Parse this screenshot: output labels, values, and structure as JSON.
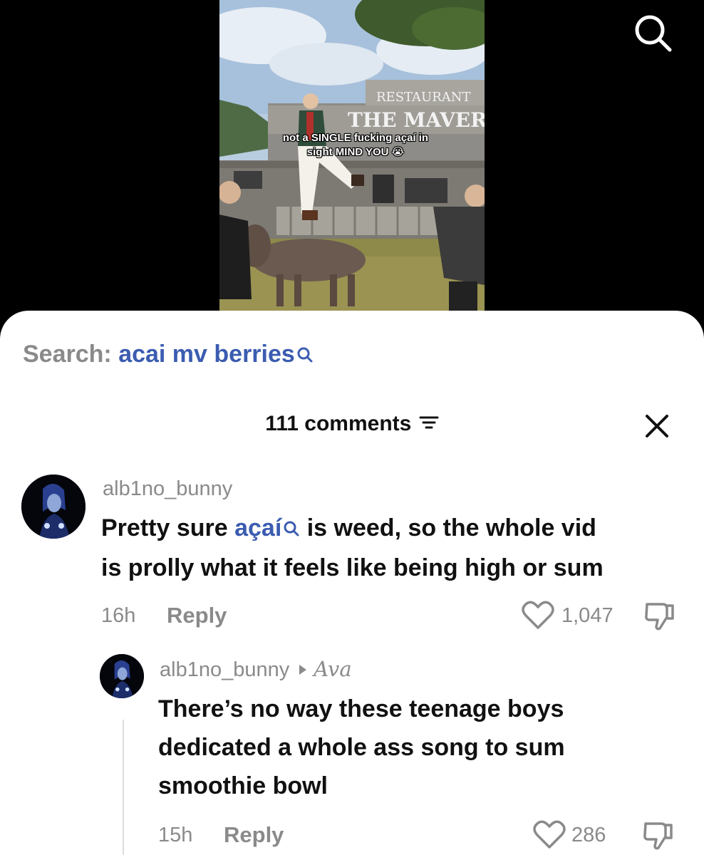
{
  "video": {
    "caption_line1": "not a SINGLE fucking açaí in",
    "caption_line2": "sight MIND YOU 😭",
    "sign_top": "RESTAURANT",
    "sign_main": "THE MAVERIC"
  },
  "search": {
    "prefix": "Search:",
    "query": "acai mv berries"
  },
  "comments_header": {
    "count_label": "111 comments"
  },
  "comments": [
    {
      "username": "alb1no_bunny",
      "text_before": "Pretty sure ",
      "link_word": "açaí",
      "text_after_line1": " is weed, so the whole vid",
      "text_line2": "is prolly what it feels like being high or sum",
      "time": "16h",
      "reply_label": "Reply",
      "likes": "1,047"
    }
  ],
  "replies": [
    {
      "username": "alb1no_bunny",
      "reply_to": "Ava",
      "text_line1": "There’s no way these teenage boys",
      "text_line2": "dedicated a whole ass song to sum",
      "text_line3": "smoothie bowl",
      "time": "15h",
      "reply_label": "Reply",
      "likes": "286"
    }
  ],
  "colors": {
    "link_blue": "#3b5cb0",
    "muted_gray": "#8a8a8a",
    "text_dark": "#111111"
  },
  "icons": [
    "search-icon",
    "sort-icon",
    "close-icon",
    "heart-icon",
    "dislike-icon"
  ]
}
